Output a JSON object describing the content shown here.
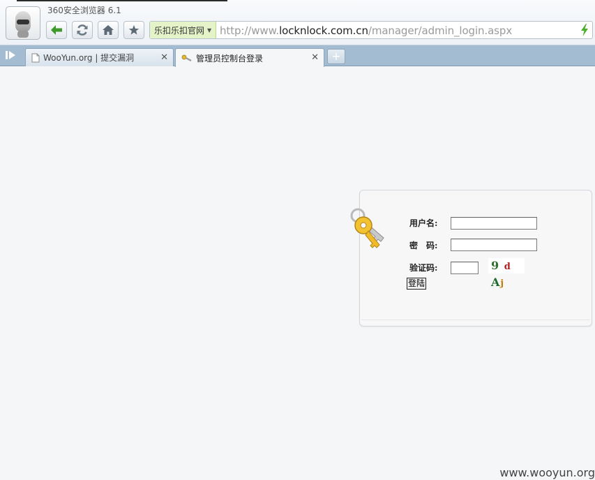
{
  "browser": {
    "app_title": "360安全浏览器 6.1",
    "site_chip": "乐扣乐扣官网",
    "url_prefix": "http://www.",
    "url_host": "locknlock.com.cn",
    "url_path": "/manager/admin_login.aspx",
    "buttons": [
      "back-icon",
      "refresh-icon",
      "home-icon",
      "favorite-star-icon"
    ]
  },
  "tabs": [
    {
      "label": "WooYun.org | 提交漏洞",
      "icon": "document-icon",
      "active": false
    },
    {
      "label": "管理员控制台登录",
      "icon": "key-page-icon",
      "active": true
    }
  ],
  "login": {
    "username_label": "用户名:",
    "password_label": "密　码:",
    "captcha_label": "验证码:",
    "username_value": "",
    "password_value": "",
    "captcha_value": "",
    "captcha_chars": [
      "9",
      "d",
      "A",
      "j"
    ],
    "submit_label": "登陆"
  },
  "watermark": "www.wooyun.org",
  "colors": {
    "accent_green": "#4caf2a",
    "tabstrip": "#a3bcd2",
    "site_chip_bg": "#e4f4c8"
  }
}
